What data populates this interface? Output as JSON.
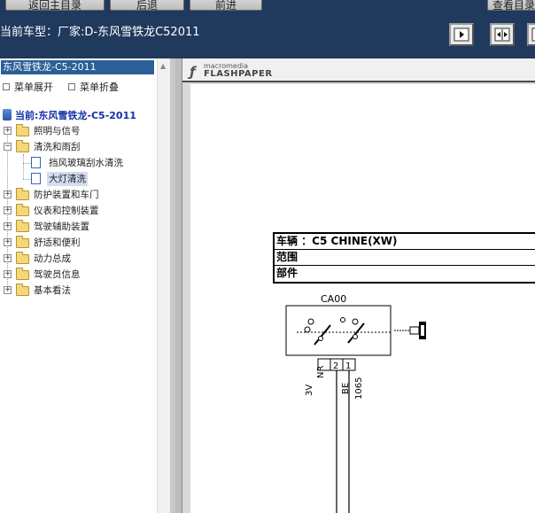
{
  "toolbar": {
    "buttons": [
      "返回主目录",
      "后退",
      "前进",
      "查看目录"
    ],
    "vehicle_label": "当前车型：厂家:D-东风雪铁龙C52011"
  },
  "tree": {
    "title": "东风雪铁龙-C5-2011",
    "expand_all": "菜单展开",
    "collapse_all": "菜单折叠",
    "root": "当前:东风雪铁龙-C5-2011",
    "nodes": [
      {
        "label": "照明与信号",
        "expander": "+"
      },
      {
        "label": "清洗和雨刮",
        "expander": "−"
      },
      {
        "label": "挡风玻璃刮水清洗",
        "child": true
      },
      {
        "label": "大灯清洗",
        "child": true,
        "selected": true
      },
      {
        "label": "防护装置和车门",
        "expander": "+"
      },
      {
        "label": "仪表和控制装置",
        "expander": "+"
      },
      {
        "label": "驾驶辅助装置",
        "expander": "+"
      },
      {
        "label": "舒适和便利",
        "expander": "+"
      },
      {
        "label": "动力总成",
        "expander": "+"
      },
      {
        "label": "驾驶员信息",
        "expander": "+"
      },
      {
        "label": "基本看法",
        "expander": "+"
      }
    ]
  },
  "viewer": {
    "logo_small": "macromedia",
    "logo_big": "FLASHPAPER",
    "info": {
      "vehicle": "车辆 ：C5 CHINE(XW)",
      "scope": "范围",
      "part": "部件"
    },
    "schematic": {
      "component": "CA00",
      "pins": [
        "2",
        "1"
      ],
      "wire_labels": [
        "3V",
        "NR",
        "BE",
        "1065"
      ]
    }
  },
  "colors": {
    "toolbar_bg": "#1f3a5c",
    "tree_title_bg": "#2b5f97",
    "root_text": "#1230a8",
    "selected_bg": "#d3dcf0"
  }
}
